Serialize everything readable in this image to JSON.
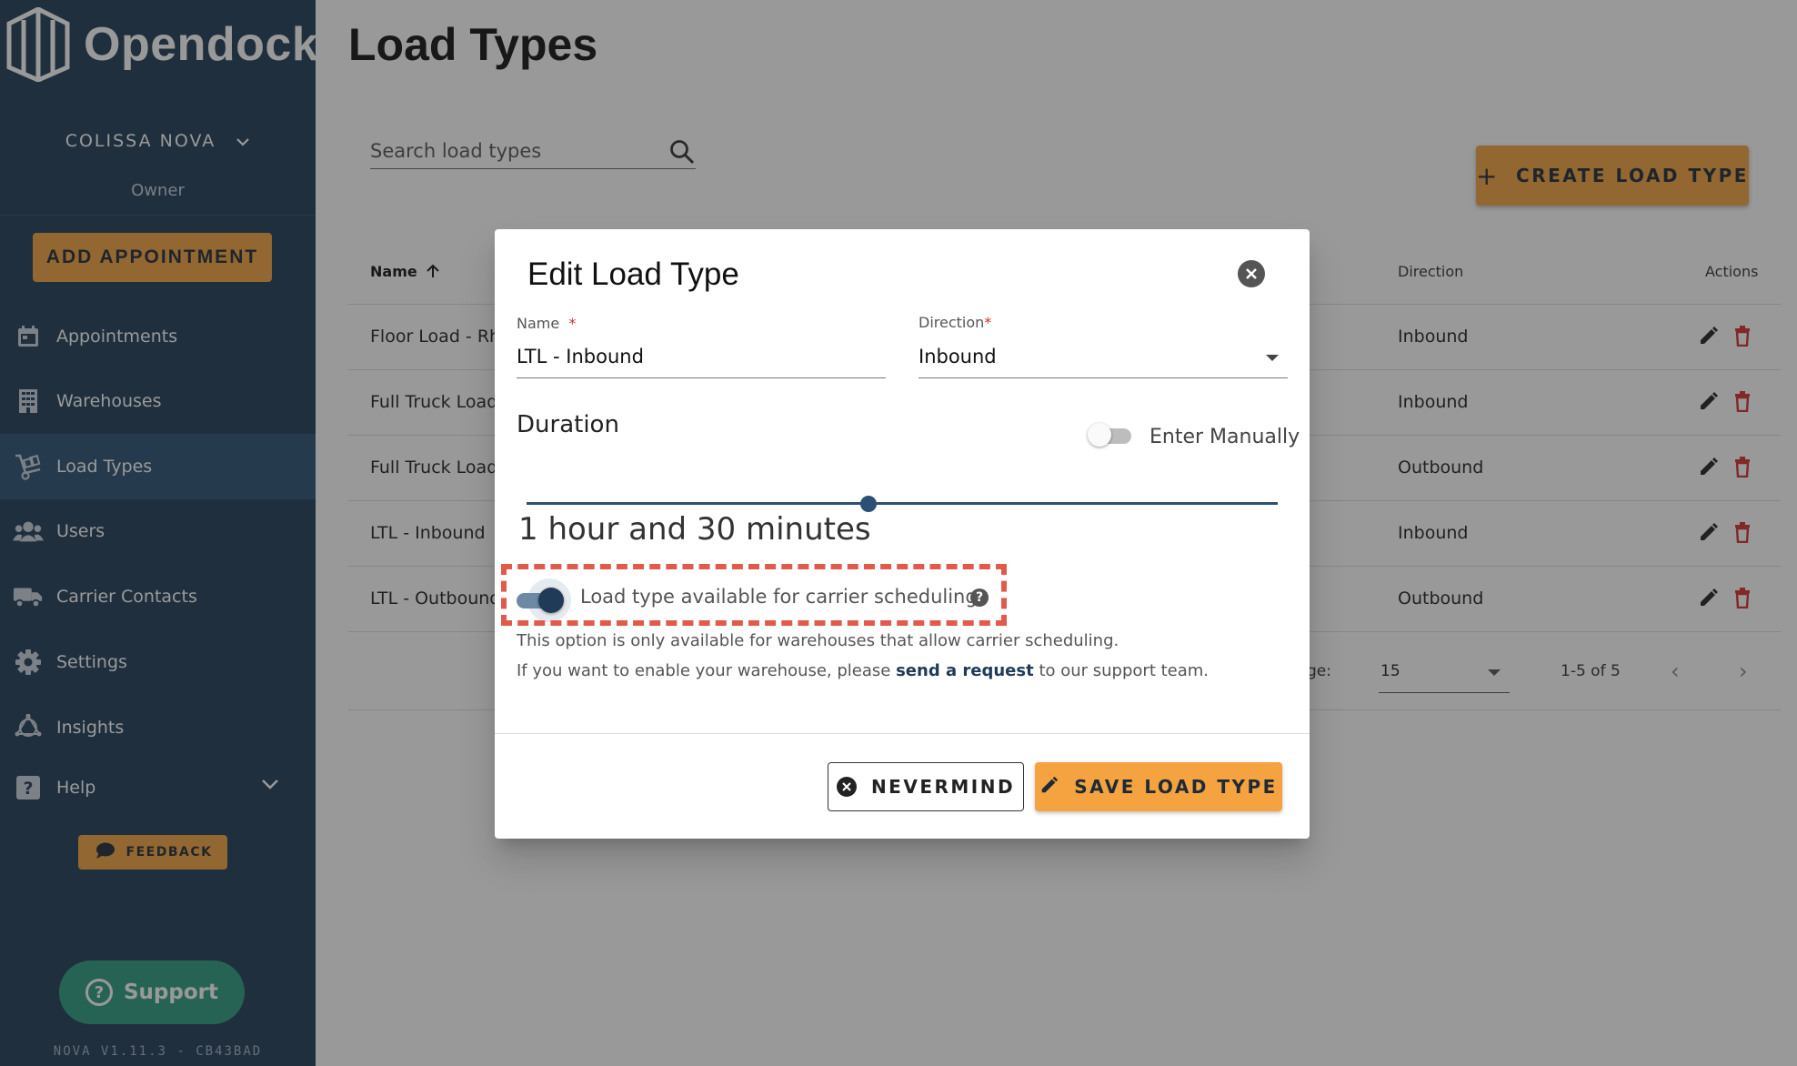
{
  "app": {
    "logo_text": "Opendock",
    "version": "NOVA V1.11.3 - CB43BAD"
  },
  "sidebar": {
    "org_name": "COLISSA NOVA",
    "role": "Owner",
    "add_appointment": "ADD APPOINTMENT",
    "items": [
      {
        "label": "Appointments",
        "icon": "calendar-icon",
        "active": false
      },
      {
        "label": "Warehouses",
        "icon": "building-icon",
        "active": false
      },
      {
        "label": "Load Types",
        "icon": "dolly-icon",
        "active": true
      },
      {
        "label": "Users",
        "icon": "users-icon",
        "active": false
      },
      {
        "label": "Carrier Contacts",
        "icon": "truck-icon",
        "active": false
      },
      {
        "label": "Settings",
        "icon": "gear-icon",
        "active": false
      },
      {
        "label": "Insights",
        "icon": "insights-icon",
        "active": false
      },
      {
        "label": "Help",
        "icon": "help-icon",
        "active": false
      }
    ],
    "feedback": "FEEDBACK",
    "support": "Support"
  },
  "main": {
    "title": "Load Types",
    "search_placeholder": "Search load types",
    "create_button": "CREATE LOAD TYPE",
    "table": {
      "columns": {
        "name": "Name",
        "direction": "Direction",
        "actions": "Actions"
      },
      "rows": [
        {
          "name": "Floor Load - Rh",
          "direction": "Inbound"
        },
        {
          "name": "Full Truck Load",
          "direction": "Inbound"
        },
        {
          "name": "Full Truck Load",
          "direction": "Outbound"
        },
        {
          "name": "LTL - Inbound",
          "direction": "Inbound"
        },
        {
          "name": "LTL - Outbound",
          "direction": "Outbound"
        }
      ]
    },
    "pagination": {
      "label": "ge:",
      "per_page": "15",
      "range": "1-5 of 5"
    }
  },
  "dialog": {
    "title": "Edit Load Type",
    "name_label": "Name",
    "name_value": "LTL - Inbound",
    "direction_label": "Direction",
    "direction_value": "Inbound",
    "duration_label": "Duration",
    "enter_manually_label": "Enter Manually",
    "enter_manually_on": false,
    "duration_value_fraction": 0.455,
    "duration_text": "1 hour and 30 minutes",
    "carrier_label": "Load type available for carrier scheduling",
    "carrier_enabled": true,
    "note_line1": "This option is only available for warehouses that allow carrier scheduling.",
    "note_line2_pre": "If you want to enable your warehouse, please ",
    "note_link": "send a request",
    "note_line2_post": " to our support team.",
    "nevermind": "NEVERMIND",
    "save": "SAVE LOAD TYPE"
  },
  "colors": {
    "sidebar": "#1f3b57",
    "sidebar_active": "#2c5075",
    "accent": "#f4a340",
    "support": "#2e9c80",
    "highlight": "#e25a4a",
    "delete": "#d32f2f"
  }
}
